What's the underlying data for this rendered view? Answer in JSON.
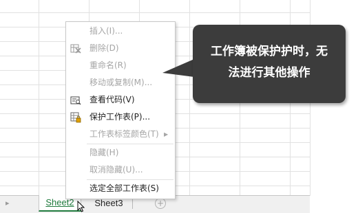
{
  "sheet_tabs": [
    {
      "label": "Sheet2"
    },
    {
      "label": "Sheet3"
    }
  ],
  "context_menu": {
    "items": [
      {
        "label": "插入(I)...",
        "enabled": false,
        "icon": ""
      },
      {
        "label": "删除(D)",
        "enabled": false,
        "icon": "delete-sheet-icon"
      },
      {
        "label": "重命名(R)",
        "enabled": false,
        "icon": ""
      },
      {
        "label": "移动或复制(M)...",
        "enabled": false,
        "icon": ""
      },
      {
        "label": "查看代码(V)",
        "enabled": true,
        "icon": "view-code-icon"
      },
      {
        "label": "保护工作表(P)...",
        "enabled": true,
        "icon": "protect-sheet-icon"
      },
      {
        "label": "工作表标签颜色(T)",
        "enabled": false,
        "icon": "",
        "submenu": true
      },
      {
        "label": "隐藏(H)",
        "enabled": false,
        "icon": ""
      },
      {
        "label": "取消隐藏(U)...",
        "enabled": false,
        "icon": ""
      },
      {
        "label": "选定全部工作表(S)",
        "enabled": true,
        "icon": ""
      }
    ]
  },
  "callout": {
    "line1": "工作簿被保护护时，无",
    "line2": "法进行其他操作"
  },
  "colors": {
    "active_tab": "#1f7a3d",
    "callout_bg": "#3c3c3c",
    "disabled_text": "#a6a6a6"
  }
}
